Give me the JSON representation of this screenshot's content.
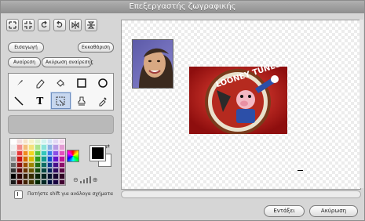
{
  "window": {
    "title": "Επεξεργαστής ζωγραφικής"
  },
  "top_tools": [
    {
      "name": "grow-icon"
    },
    {
      "name": "shrink-icon"
    },
    {
      "name": "rotate-left-icon"
    },
    {
      "name": "rotate-right-icon"
    },
    {
      "name": "flip-horizontal-icon"
    },
    {
      "name": "flip-vertical-icon"
    }
  ],
  "buttons": {
    "import": "Εισαγωγή",
    "clear": "Εκκαθάριση",
    "undo": "Αναίρεση",
    "redo": "Ακύρωση αναίρεσης"
  },
  "tools": [
    {
      "name": "brush-tool-icon"
    },
    {
      "name": "eraser-tool-icon"
    },
    {
      "name": "fill-tool-icon"
    },
    {
      "name": "rectangle-tool-icon"
    },
    {
      "name": "ellipse-tool-icon"
    },
    {
      "name": "line-tool-icon"
    },
    {
      "name": "text-tool-icon",
      "label": "T"
    },
    {
      "name": "select-tool-icon",
      "selected": true
    },
    {
      "name": "stamp-tool-icon"
    },
    {
      "name": "eyedropper-tool-icon"
    }
  ],
  "palette": [
    "#ffffff",
    "#f2dede",
    "#f6e3c9",
    "#f6f2c9",
    "#dff3d2",
    "#d2f3ef",
    "#d2e2f6",
    "#e4d8f4",
    "#f4d8ee",
    "#eeeeee",
    "#f08c8c",
    "#f3bd7a",
    "#f3e27a",
    "#a9e38b",
    "#8be3da",
    "#8bb3e3",
    "#b79be3",
    "#e39bd3",
    "#cccccc",
    "#e63a3a",
    "#f08a1e",
    "#f0d51e",
    "#57c43a",
    "#33c7bb",
    "#3a7de6",
    "#8a4fe6",
    "#e34fbe",
    "#999999",
    "#c81414",
    "#d36a00",
    "#d6b800",
    "#2f9a1c",
    "#149a8f",
    "#144fc8",
    "#6414c8",
    "#c01496",
    "#666666",
    "#8a0e0e",
    "#9a4c00",
    "#9a8400",
    "#1f6b12",
    "#0e6b63",
    "#0e368a",
    "#460e8a",
    "#8a0e68",
    "#333333",
    "#5a0909",
    "#663200",
    "#665700",
    "#14470c",
    "#094742",
    "#09245c",
    "#2e095c",
    "#5c0945",
    "#000000",
    "#2b0505",
    "#331900",
    "#332c00",
    "#0a2406",
    "#052421",
    "#05122e",
    "#17052e",
    "#2e0523",
    "#1a1a1a",
    "#400",
    "#402000",
    "#403700",
    "#002800",
    "#002825",
    "#001040",
    "#180040",
    "#400030"
  ],
  "colors": {
    "foreground": "#000000",
    "background": "#ffffff",
    "accent": "#6f8fbf"
  },
  "option": {
    "hint": "Πατήστε shift για ανάλογα σχήματα"
  },
  "footer": {
    "ok": "Εντάξει",
    "cancel": "Ακύρωση"
  },
  "canvas": {
    "photo": {
      "name": "photo-of-girl"
    },
    "cartoon": {
      "name": "looney-tunes-porky-pig",
      "text": "LOONEY TUNES"
    }
  }
}
